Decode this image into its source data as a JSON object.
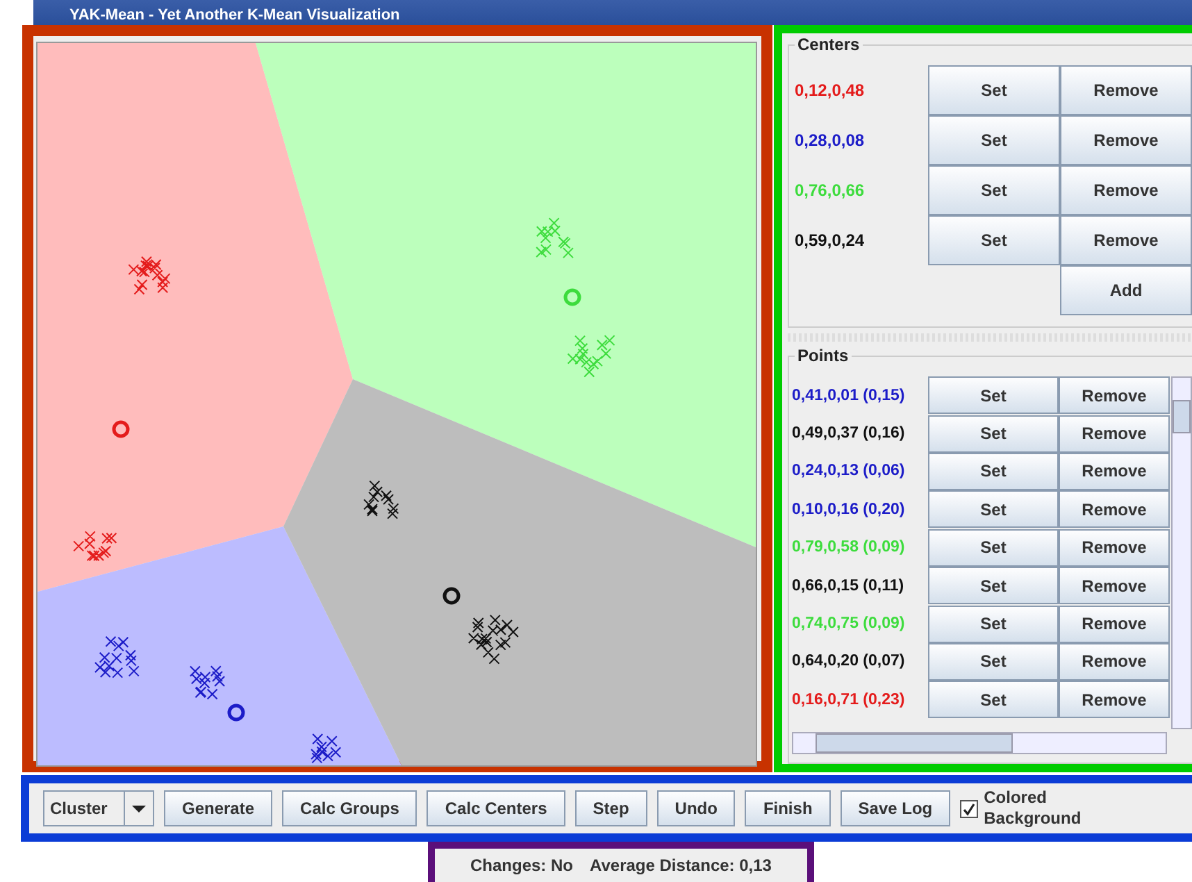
{
  "window": {
    "title": "YAK-Mean - Yet Another K-Mean Visualization"
  },
  "centers": {
    "title": "Centers",
    "items": [
      {
        "label": "0,12,0,48",
        "color": "#e41b1b",
        "set": "Set",
        "remove": "Remove"
      },
      {
        "label": "0,28,0,08",
        "color": "#1c1cc8",
        "set": "Set",
        "remove": "Remove"
      },
      {
        "label": "0,76,0,66",
        "color": "#3ddc3d",
        "set": "Set",
        "remove": "Remove"
      },
      {
        "label": "0,59,0,24",
        "color": "#111111",
        "set": "Set",
        "remove": "Remove"
      }
    ],
    "add": "Add"
  },
  "points": {
    "title": "Points",
    "items": [
      {
        "label": "0,41,0,01 (0,15)",
        "color": "#1c1cc8",
        "set": "Set",
        "remove": "Remove"
      },
      {
        "label": "0,49,0,37 (0,16)",
        "color": "#111111",
        "set": "Set",
        "remove": "Remove"
      },
      {
        "label": "0,24,0,13 (0,06)",
        "color": "#1c1cc8",
        "set": "Set",
        "remove": "Remove"
      },
      {
        "label": "0,10,0,16 (0,20)",
        "color": "#1c1cc8",
        "set": "Set",
        "remove": "Remove"
      },
      {
        "label": "0,79,0,58 (0,09)",
        "color": "#3ddc3d",
        "set": "Set",
        "remove": "Remove"
      },
      {
        "label": "0,66,0,15 (0,11)",
        "color": "#111111",
        "set": "Set",
        "remove": "Remove"
      },
      {
        "label": "0,74,0,75 (0,09)",
        "color": "#3ddc3d",
        "set": "Set",
        "remove": "Remove"
      },
      {
        "label": "0,64,0,20 (0,07)",
        "color": "#111111",
        "set": "Set",
        "remove": "Remove"
      },
      {
        "label": "0,16,0,71 (0,23)",
        "color": "#e41b1b",
        "set": "Set",
        "remove": "Remove"
      }
    ]
  },
  "toolbar": {
    "mode": "Cluster",
    "buttons": [
      "Generate",
      "Calc Groups",
      "Calc Centers",
      "Step",
      "Undo",
      "Finish",
      "Save Log"
    ],
    "colored_background": {
      "label_1": "Colored",
      "label_2": "Background",
      "checked": true
    }
  },
  "status": {
    "changes_label": "Changes:",
    "changes_value": "No",
    "distance_label": "Average Distance:",
    "distance_value": "0,13"
  }
}
